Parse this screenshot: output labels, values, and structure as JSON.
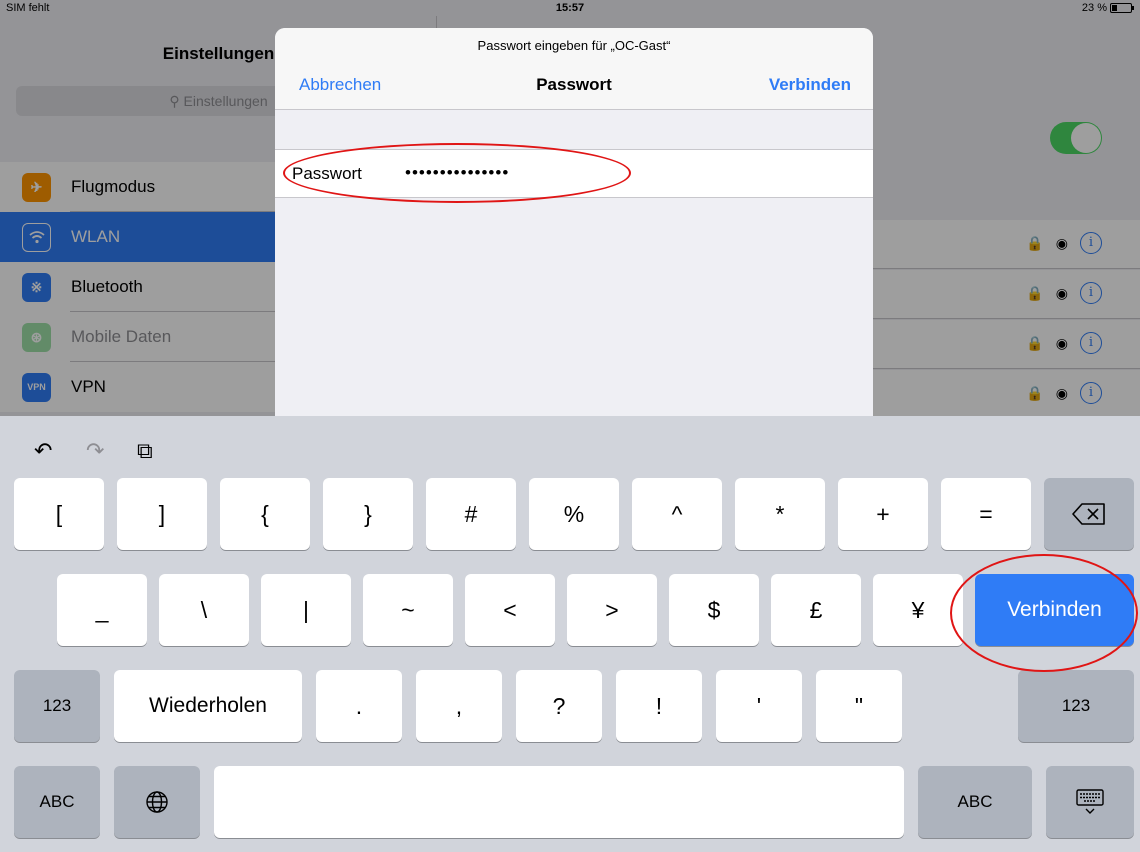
{
  "status": {
    "carrier": "SIM fehlt",
    "time": "15:57",
    "battery": "23 %"
  },
  "master": {
    "title": "Einstellungen",
    "search_placeholder": "Einstellungen",
    "items": [
      {
        "label": "Flugmodus",
        "icon": "airplane-icon",
        "color": "#ff9500"
      },
      {
        "label": "WLAN",
        "icon": "wifi-icon",
        "color": "#2f7cf6"
      },
      {
        "label": "Bluetooth",
        "icon": "bluetooth-icon",
        "color": "#2f7cf6"
      },
      {
        "label": "Mobile Daten",
        "icon": "antenna-icon",
        "color": "#4cd964"
      },
      {
        "label": "VPN",
        "icon": "vpn-icon",
        "color": "#2f7cf6"
      }
    ]
  },
  "modal": {
    "prompt": "Passwort eingeben für „OC-Gast“",
    "cancel": "Abbrechen",
    "title": "Passwort",
    "connect": "Verbinden",
    "field_label": "Passwort",
    "field_value": "•••••••••••••••"
  },
  "keyboard": {
    "row1": [
      "[",
      "]",
      "{",
      "}",
      "#",
      "%",
      "^",
      "*",
      "+",
      "="
    ],
    "row2": [
      "_",
      "\\",
      "|",
      "~",
      "<",
      ">",
      "$",
      "£",
      "¥"
    ],
    "connect": "Verbinden",
    "row3_left": "123",
    "redo": "Wiederholen",
    "row3": [
      ".",
      ",",
      "?",
      "!",
      "'",
      "\""
    ],
    "row3_right": "123",
    "abc_left": "ABC",
    "abc_right": "ABC"
  },
  "colors": {
    "accent": "#2f7cf6",
    "highlight": "#e01515"
  }
}
